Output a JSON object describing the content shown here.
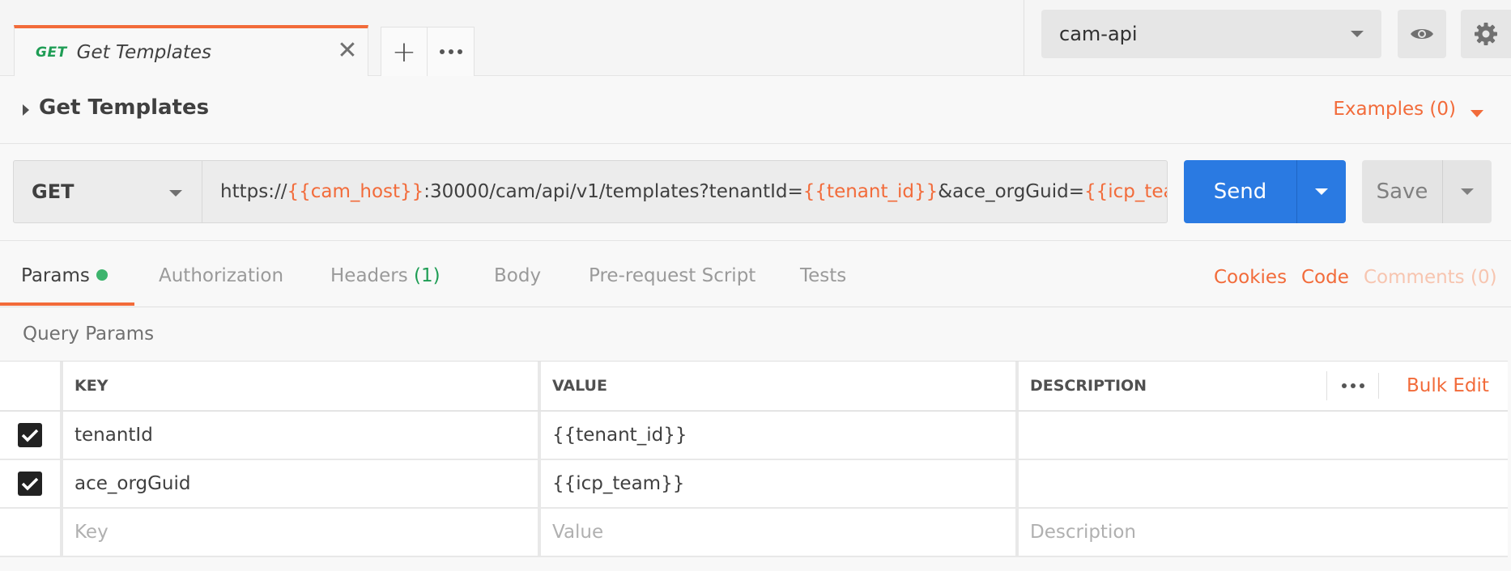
{
  "tabs": {
    "active": {
      "method": "GET",
      "title": "Get Templates",
      "close_glyph": "✕"
    },
    "new_tab_glyph": "+"
  },
  "environment": {
    "selected": "cam-api"
  },
  "request": {
    "name": "Get Templates",
    "examples_label": "Examples (0)",
    "method": "GET",
    "url_parts": {
      "p1": "https://",
      "v1": "{{cam_host}}",
      "p2": ":30000/cam/api/v1/templates?tenantId=",
      "v2": "{{tenant_id}}",
      "p3": "&ace_orgGuid=",
      "v3": "{{icp_team}}"
    },
    "send_label": "Send",
    "save_label": "Save"
  },
  "subtabs": {
    "params": "Params",
    "authorization": "Authorization",
    "headers": "Headers",
    "headers_count": "(1)",
    "body": "Body",
    "prerequest": "Pre-request Script",
    "tests": "Tests",
    "cookies": "Cookies",
    "code": "Code",
    "comments": "Comments (0)"
  },
  "query_params": {
    "title": "Query Params",
    "columns": {
      "key": "KEY",
      "value": "VALUE",
      "description": "DESCRIPTION"
    },
    "bulk_edit": "Bulk Edit",
    "rows": [
      {
        "checked": true,
        "key": "tenantId",
        "value": "{{tenant_id}}",
        "description": ""
      },
      {
        "checked": true,
        "key": "ace_orgGuid",
        "value": "{{icp_team}}",
        "description": ""
      }
    ],
    "placeholders": {
      "key": "Key",
      "value": "Value",
      "description": "Description"
    }
  },
  "colors": {
    "accent": "#f26b3a",
    "send": "#2a7ae2",
    "get_method": "#1f9d55",
    "status_dot": "#3db46d"
  }
}
